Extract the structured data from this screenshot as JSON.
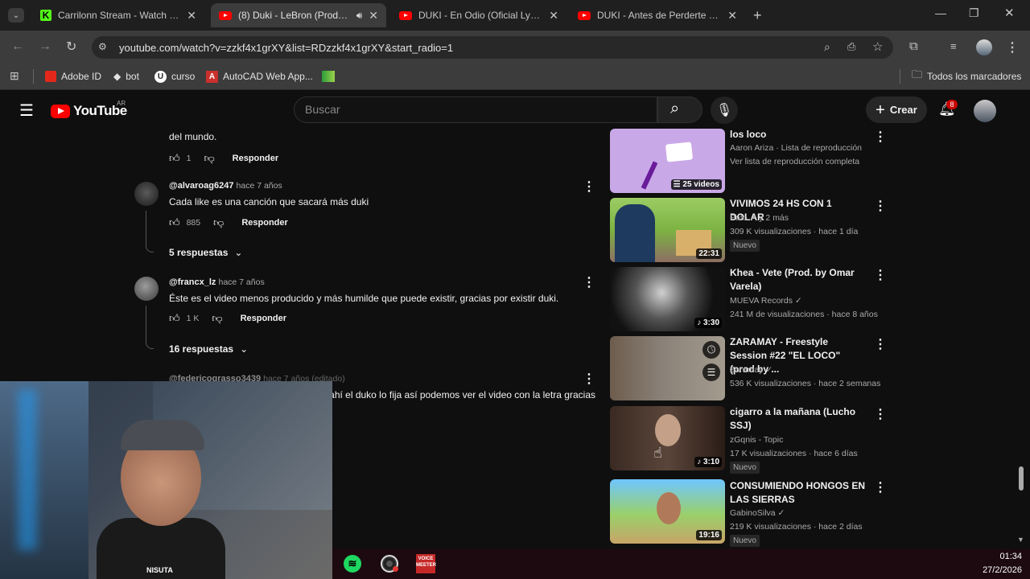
{
  "tabs": [
    {
      "title": "Carrilonn Stream - Watch Live o",
      "icon": "kick-icon"
    },
    {
      "title": "(8) Duki - LeBron (Prod. Roja",
      "icon": "youtube-icon",
      "active": true
    },
    {
      "title": "DUKI - En Odio (Oficial Lyric Vid",
      "icon": "youtube-icon"
    },
    {
      "title": "DUKI - Antes de Perderte (Vide",
      "icon": "youtube-icon"
    }
  ],
  "url": "youtube.com/watch?v=zzkf4x1grXY&list=RDzzkf4x1grXY&start_radio=1",
  "bookmarks": [
    "Adobe ID",
    "bot",
    "curso",
    "AutoCAD Web App..."
  ],
  "all_bookmarks": "Todos los marcadores",
  "yt": {
    "logo": "YouTube",
    "region": "AR",
    "search_placeholder": "Buscar",
    "create": "Crear",
    "notif_count": "8"
  },
  "comments": {
    "partial_text": "del mundo.",
    "reply_label": "Responder",
    "c1_likes": "1",
    "c2": {
      "author": "@alvaroag6247",
      "time": "hace 7 años",
      "text": "Cada like es una canción que sacará más duki",
      "likes": "885",
      "replies": "5 respuestas"
    },
    "c3": {
      "author": "@francx_lz",
      "time": "hace 7 años",
      "text": "Éste es el video menos producido y más humilde que puede existir, gracias por existir duki.",
      "likes": "1 K",
      "replies": "16 respuestas"
    },
    "c4": {
      "author": "@federicograsso3439",
      "time": "hace 7 años (editado)",
      "text": "ahí el duko lo fija así podemos ver el video con la letra gracias"
    }
  },
  "recs": [
    {
      "title": "los loco",
      "meta1": "Aaron Ariza · Lista de reproducción",
      "meta2": "Ver lista de reproducción completa",
      "badge": "25 videos"
    },
    {
      "title": "VIVIMOS 24 HS CON 1 DOLAR",
      "channel": "Pato",
      "meta1_suffix": "y 2 más",
      "meta2": "309 K visualizaciones · hace 1 día",
      "tag": "Nuevo",
      "dur": "22:31"
    },
    {
      "title": "Khea - Vete (Prod. by Omar Varela)",
      "channel": "MUEVA Records",
      "meta2": "241 M de visualizaciones · hace 8 años",
      "dur": "3:30"
    },
    {
      "title": "ZARAMAY - Freestyle Session #22 \"EL LOCO\" (prod by ...",
      "channel": "Zaramay",
      "meta2": "536 K visualizaciones · hace 2 semanas"
    },
    {
      "title": "cigarro a la mañana (Lucho SSJ)",
      "channel": "zGqnis - Topic",
      "meta2": "17 K visualizaciones · hace 6 días",
      "tag": "Nuevo",
      "dur": "3:10"
    },
    {
      "title": "CONSUMIENDO HONGOS EN LAS SIERRAS",
      "channel": "GabinoSilva",
      "meta2": "219 K visualizaciones · hace 2 días",
      "tag": "Nuevo",
      "dur": "19:16"
    }
  ],
  "webcam_label": "NISUTA",
  "clock": {
    "time": "01:34",
    "date": "27/2/2026"
  },
  "taskbar": [
    "spotify-icon",
    "obs-icon",
    "voicemeeter-icon"
  ],
  "taskbar_voice": [
    "VOICE",
    "MEETER"
  ]
}
